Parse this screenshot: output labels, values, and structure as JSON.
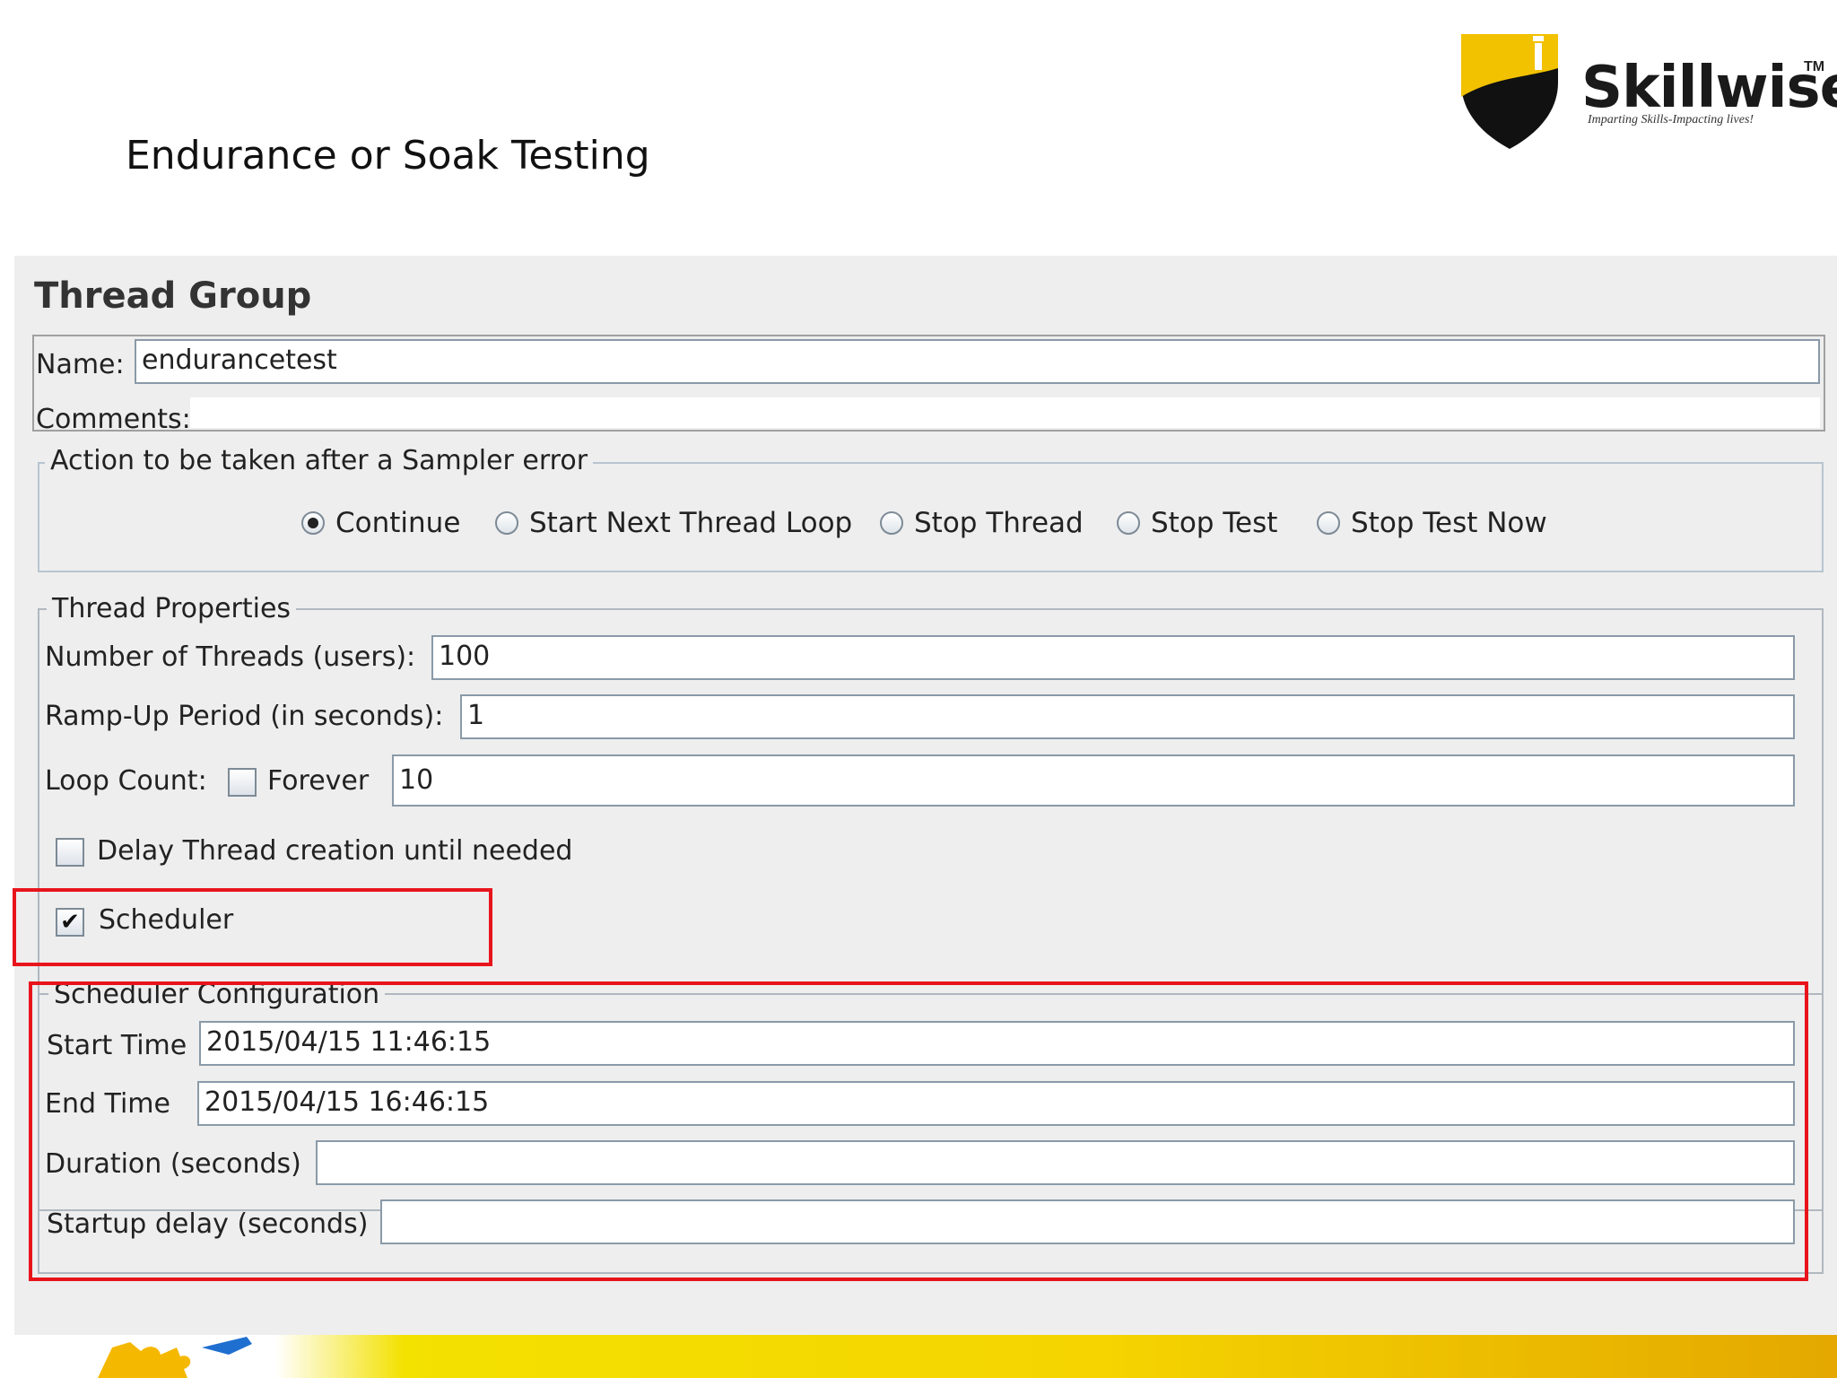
{
  "slide": {
    "title": "Endurance or Soak Testing"
  },
  "logo": {
    "brand": "Skillwise",
    "tm": "TM",
    "tagline": "Imparting Skills-Impacting lives!"
  },
  "thread_group": {
    "title": "Thread Group",
    "name_label": "Name:",
    "name_value": "endurancetest",
    "comments_label": "Comments:",
    "comments_value": ""
  },
  "sampler_error": {
    "legend": "Action to be taken after a Sampler error",
    "options": [
      {
        "label": "Continue",
        "selected": true
      },
      {
        "label": "Start Next Thread Loop",
        "selected": false
      },
      {
        "label": "Stop Thread",
        "selected": false
      },
      {
        "label": "Stop Test",
        "selected": false
      },
      {
        "label": "Stop Test Now",
        "selected": false
      }
    ]
  },
  "thread_properties": {
    "legend": "Thread Properties",
    "threads_label": "Number of Threads (users):",
    "threads_value": "100",
    "rampup_label": "Ramp-Up Period (in seconds):",
    "rampup_value": "1",
    "loop_label": "Loop Count:",
    "forever_label": "Forever",
    "forever_checked": false,
    "loop_value": "10",
    "delay_label": "Delay Thread creation until needed",
    "delay_checked": false,
    "scheduler_label": "Scheduler",
    "scheduler_checked": true,
    "check_mark": "✔"
  },
  "scheduler_config": {
    "legend": "Scheduler Configuration",
    "start_label": "Start Time",
    "start_value": "2015/04/15 11:46:15",
    "end_label": "End Time",
    "end_value": "2015/04/15 16:46:15",
    "duration_label": "Duration (seconds)",
    "duration_value": "",
    "startup_label": "Startup delay (seconds)",
    "startup_value": ""
  },
  "colors": {
    "highlight": "#e8141c",
    "panel_bg": "#eeeeee",
    "logo_yellow": "#f2c100"
  },
  "icons": {
    "logo": "skillwise-shield-icon",
    "puzzle": "puzzle-piece-icon"
  }
}
